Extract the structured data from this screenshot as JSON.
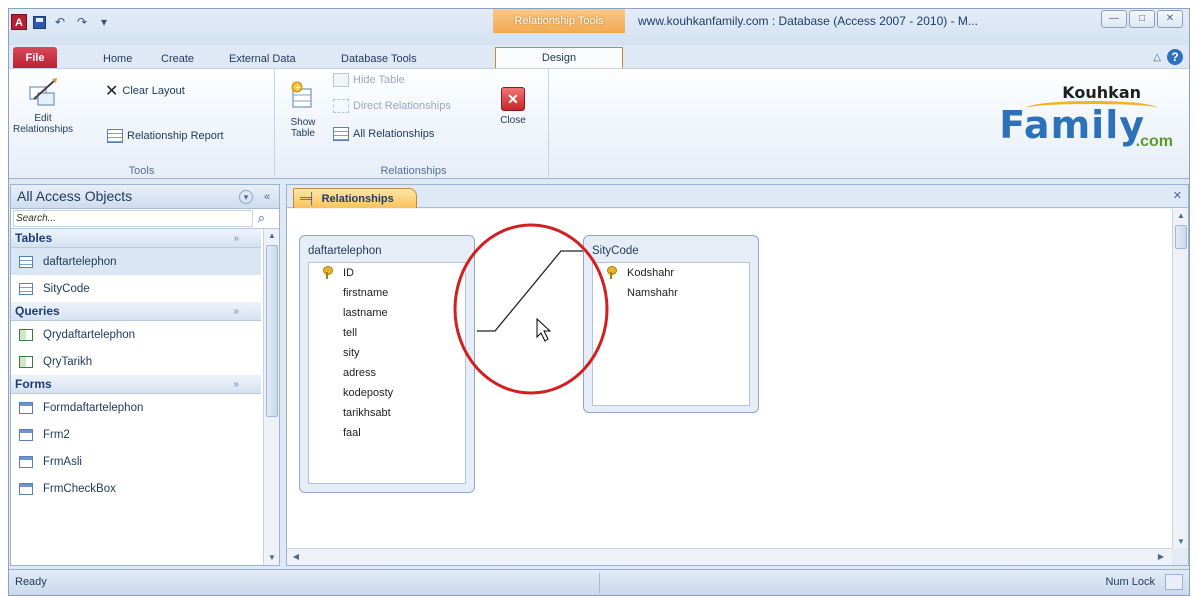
{
  "app": {
    "window_title": "www.kouhkanfamily.com : Database (Access 2007 - 2010) - M...",
    "context_tab_header": "Relationship Tools",
    "app_icon_letter": "A",
    "window_buttons": [
      "—",
      "□",
      "✕"
    ]
  },
  "ribbon": {
    "tabs": [
      {
        "label": "File"
      },
      {
        "label": "Home"
      },
      {
        "label": "Create"
      },
      {
        "label": "External Data"
      },
      {
        "label": "Database Tools"
      },
      {
        "label": "Design"
      }
    ],
    "groups": {
      "tools": {
        "label": "Tools",
        "edit_relationships": "Edit Relationships",
        "clear_layout": "Clear Layout",
        "relationship_report": "Relationship Report"
      },
      "relationships": {
        "label": "Relationships",
        "show_table": "Show Table",
        "hide_table": "Hide Table",
        "direct_relationships": "Direct Relationships",
        "all_relationships": "All Relationships",
        "close": "Close"
      }
    },
    "logo": {
      "top": "Kouhkan",
      "main": "Family",
      "sub": ".com"
    }
  },
  "nav": {
    "title": "All Access Objects",
    "search_placeholder": "Search...",
    "groups": [
      {
        "label": "Tables",
        "items": [
          "daftartelephon",
          "SityCode"
        ]
      },
      {
        "label": "Queries",
        "items": [
          "Qrydaftartelephon",
          "QryTarikh"
        ]
      },
      {
        "label": "Forms",
        "items": [
          "Formdaftartelephon",
          "Frm2",
          "FrmAsli",
          "FrmCheckBox"
        ]
      }
    ]
  },
  "document": {
    "tab_label": "Relationships",
    "tables": [
      {
        "name": "daftartelephon",
        "key_field": "ID",
        "fields": [
          "ID",
          "firstname",
          "lastname",
          "tell",
          "sity",
          "adress",
          "kodeposty",
          "tarikhsabt",
          "faal"
        ]
      },
      {
        "name": "SityCode",
        "key_field": "Kodshahr",
        "fields": [
          "Kodshahr",
          "Namshahr"
        ]
      }
    ],
    "relationship": {
      "from_table": "daftartelephon",
      "from_field": "sity",
      "to_table": "SityCode",
      "to_field": "Kodshahr"
    }
  },
  "status": {
    "left": "Ready",
    "right": "Num Lock"
  },
  "colors": {
    "accent_file_tab": "#b8202f",
    "context_tab": "#f2a94e",
    "highlight_ring": "#d21f1f"
  }
}
